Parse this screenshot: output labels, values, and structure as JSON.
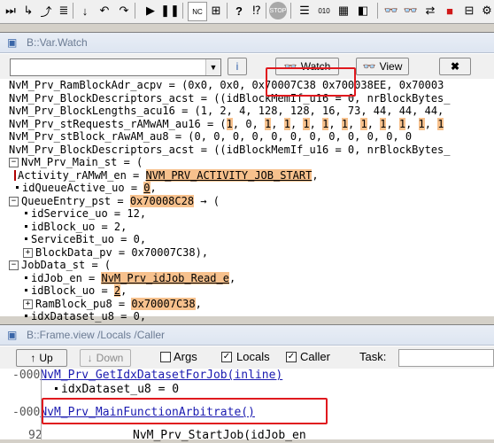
{
  "watch": {
    "title": "B::Var.Watch",
    "watch_button": "Watch",
    "view_button": "View"
  },
  "lines": {
    "l1": "NvM_Prv_RamBlockAdr_acpv = (0x0, 0x0, ",
    "l1_addr": "0x70007C38",
    "l1_rest": " 0x700038EE, 0x70003",
    "l2": "NvM_Prv_BlockDescriptors_acst = ((idBlockMemIf_u16 = 0, nrBlockBytes_",
    "l3": "NvM_Prv_BlockLengths_acu16 = (1, 2, 4, 128, 128, 16, 73, 44, 44, 44,",
    "l4a": "NvM_Prv_stRequests_rAMwAM_au16 = (",
    "l4_vals": [
      "1",
      "0",
      "1",
      "1",
      "1",
      "1",
      "1",
      "1",
      "1",
      "1",
      "1",
      "1"
    ],
    "l5": "NvM_Prv_stBlock_rAwAM_au8 = (0, 0, 0, 0, 0, 0, 0, 0, 0, 0, 0, 0",
    "l6": "NvM_Prv_BlockDescriptors_acst = ((idBlockMemIf_u16 = 0, nrBlockBytes_",
    "l7": "NvM_Prv_Main_st = (",
    "l8a": "Activity_rAMwM_en = ",
    "l8b": "NVM_PRV_ACTIVITY_JOB_START",
    "l9a": "idQueueActive_uo = ",
    "l9b": "0",
    "l10a": "QueueEntry_pst = ",
    "l10b": "0x70008C28",
    "l10c": " → (",
    "l11": "idService_uo = 12,",
    "l12": "idBlock_uo = 2,",
    "l13": "ServiceBit_uo = 0,",
    "l14": "BlockData_pv = 0x70007C38),",
    "l15": "JobData_st = (",
    "l16a": "idJob_en = ",
    "l16b": "NvM_Prv_idJob_Read_e",
    "l17a": "idBlock_uo = ",
    "l17b": "2",
    "l18a": "RamBlock_pu8 = ",
    "l18b": "0x70007C38",
    "l19": "idxDataset_u8 = 0,"
  },
  "frame": {
    "title": "B::Frame.view /Locals /Caller",
    "up": "Up",
    "down": "Down",
    "args": "Args",
    "locals": "Locals",
    "caller": "Caller",
    "task": "Task:",
    "r1_num": "-000",
    "r1_text": "NvM_Prv_GetIdxDatasetForJob(inline)",
    "r2_text": "idxDataset_u8 = 0",
    "r3_num": "-000",
    "r3_text": "NvM_Prv_MainFunctionArbitrate()",
    "r4_num": "92",
    "r4_text": "NvM_Prv_StartJob(idJob_en"
  },
  "colors": {
    "highlight": "#f7c18d",
    "annotation_red": "#e0191e"
  }
}
